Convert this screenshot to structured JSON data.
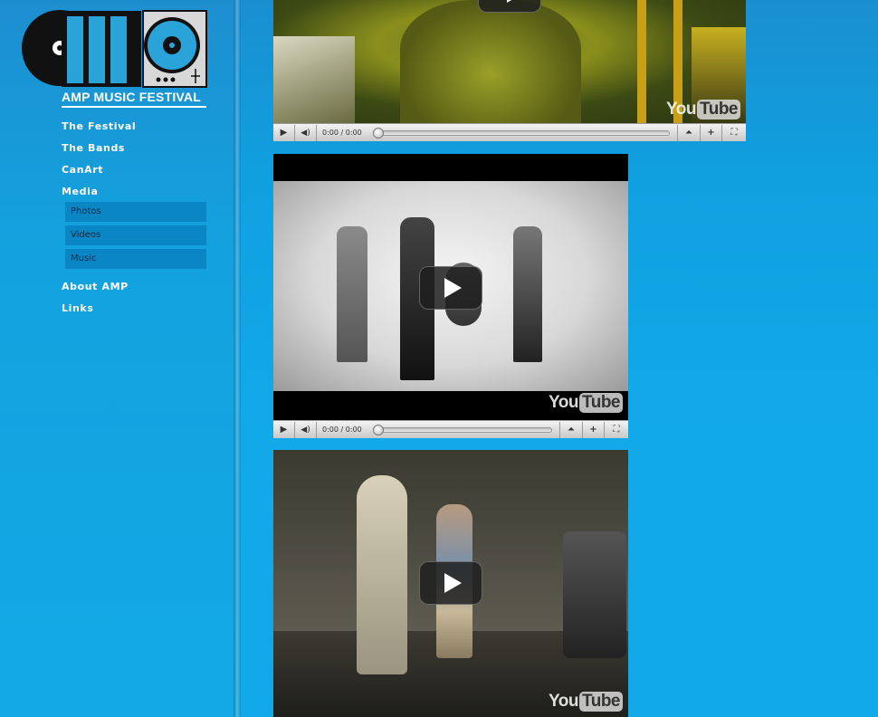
{
  "brand": {
    "logo_text": "AMP MUSIC FESTIVAL",
    "accent": "#11a7e5",
    "logo_blue": "#29a3d8"
  },
  "nav": {
    "items": [
      {
        "label": "The Festival"
      },
      {
        "label": "The Bands"
      },
      {
        "label": "CanArt"
      },
      {
        "label": "Media"
      },
      {
        "label": "About AMP"
      },
      {
        "label": "Links"
      }
    ],
    "media_submenu": [
      {
        "label": "Photos"
      },
      {
        "label": "Videos"
      },
      {
        "label": "Music"
      }
    ]
  },
  "videos": [
    {
      "time": "0:00 / 0:00",
      "watermark_you": "You",
      "watermark_tube": "Tube"
    },
    {
      "time": "0:00 / 0:00",
      "watermark_you": "You",
      "watermark_tube": "Tube"
    },
    {
      "time": "0:00 / 0:00",
      "watermark_you": "You",
      "watermark_tube": "Tube"
    }
  ],
  "icons": [
    "play-icon",
    "volume-icon",
    "menu-up-icon",
    "plus-icon",
    "fullscreen-icon",
    "play-overlay-icon",
    "vinyl-record-icon",
    "turntable-icon"
  ]
}
